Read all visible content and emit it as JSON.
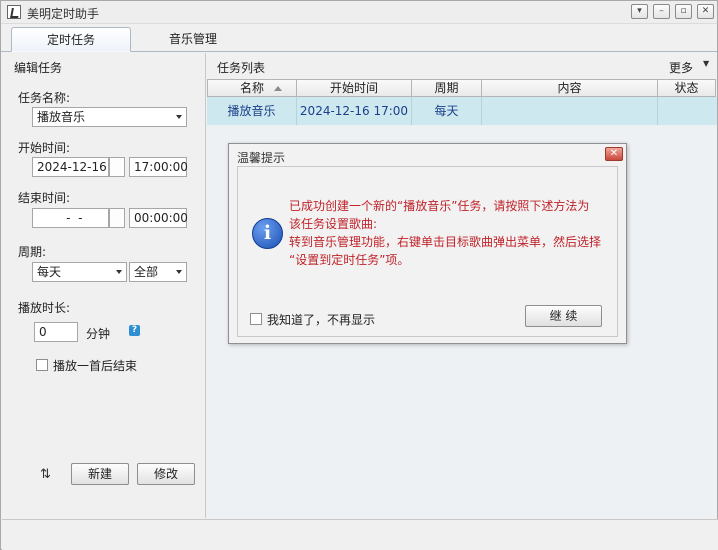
{
  "window": {
    "title": "美明定时助手",
    "controls": [
      "▾",
      "–",
      "▫",
      "✕"
    ]
  },
  "tabs": [
    {
      "label": "定时任务",
      "active": true
    },
    {
      "label": "音乐管理",
      "active": false
    }
  ],
  "edit_panel": {
    "title": "编辑任务",
    "task_name_label": "任务名称:",
    "task_name_value": "播放音乐",
    "start_label": "开始时间:",
    "start_date": "2024-12-16",
    "start_time": "17:00:00",
    "end_label": "结束时间:",
    "end_date": "  -  -",
    "end_time": "00:00:00",
    "period_label": "周期:",
    "period_value": "每天",
    "period_scope": "全部",
    "duration_label": "播放时长:",
    "duration_value": "0",
    "duration_unit": "分钟",
    "help_glyph": "?",
    "stop_after_one_label": "播放一首后结束",
    "refresh_glyph": "⇅",
    "create_button": "新建",
    "modify_button": "修改"
  },
  "task_list": {
    "title": "任务列表",
    "more_label": "更多",
    "more_arrow": "▼",
    "columns": [
      "名称",
      "开始时间",
      "周期",
      "内容",
      "状态"
    ],
    "rows": [
      {
        "name": "播放音乐",
        "start": "2024-12-16 17:00",
        "period": "每天",
        "content": "",
        "status": ""
      }
    ]
  },
  "dialog": {
    "title": "温馨提示",
    "close_glyph": "✕",
    "info_glyph": "i",
    "lines": [
      "已成功创建一个新的“播放音乐”任务，请按照下述方法为",
      "该任务设置歌曲:",
      "转到音乐管理功能，右键单击目标歌曲弹出菜单，然后选择",
      "“设置到定时任务”项。"
    ],
    "dont_show_label": "我知道了，不再显示",
    "continue_button": "继 续"
  },
  "colors": {
    "selected_row": "#cde9ef",
    "dialog_text": "#c0232a",
    "info_icon": "#1a4fb4"
  }
}
